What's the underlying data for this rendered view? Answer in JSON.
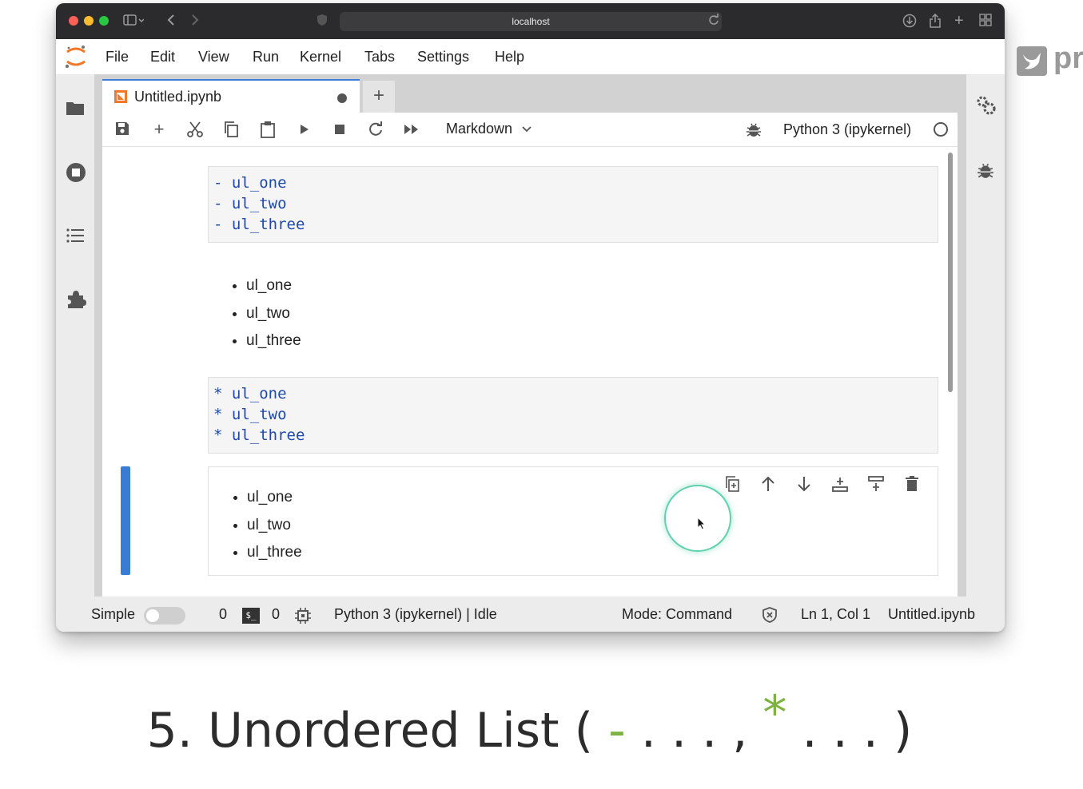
{
  "browser": {
    "url": "localhost"
  },
  "menu": [
    "File",
    "Edit",
    "View",
    "Run",
    "Kernel",
    "Tabs",
    "Settings",
    "Help"
  ],
  "tab": {
    "title": "Untitled.ipynb",
    "add_label": "+"
  },
  "toolbar": {
    "cell_type": "Markdown",
    "kernel": "Python 3 (ipykernel)"
  },
  "cells": {
    "dash_source": [
      "- ul_one",
      "- ul_two",
      "- ul_three"
    ],
    "dash_rendered": [
      "ul_one",
      "ul_two",
      "ul_three"
    ],
    "star_source": [
      "* ul_one",
      "* ul_two",
      "* ul_three"
    ],
    "star_rendered": [
      "ul_one",
      "ul_two",
      "ul_three"
    ]
  },
  "status": {
    "mode_label": "Simple",
    "count_a": "0",
    "terminal_label": "$_",
    "count_b": "0",
    "kernel_status": "Python 3 (ipykernel) | Idle",
    "mode": "Mode: Command",
    "position": "Ln 1, Col 1",
    "file": "Untitled.ipynb"
  },
  "caption": {
    "prefix": "5. Unordered List ( ",
    "dash": "-",
    "middle": " . . . , ",
    "star": "*",
    "suffix": " . . . )"
  },
  "brand": {
    "text": "pr"
  },
  "colors": {
    "accent": "#3a7bd5",
    "code": "#1f4aa8",
    "caption_symbol": "#7cb342",
    "cursor_ring": "#5fd1ad",
    "jupyter_orange": "#f37726"
  }
}
